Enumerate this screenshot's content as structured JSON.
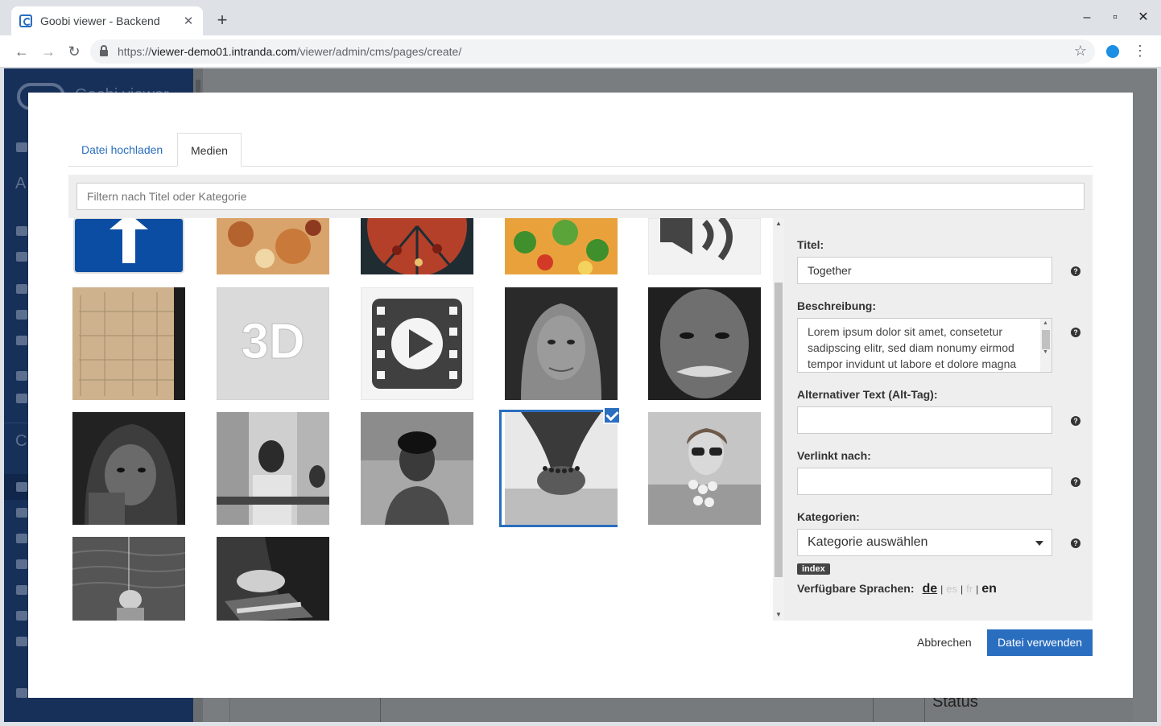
{
  "browser": {
    "tab_title": "Goobi viewer - Backend",
    "url_prefix": "https://",
    "url_host": "viewer-demo01.intranda.com",
    "url_path": "/viewer/admin/cms/pages/create/"
  },
  "background": {
    "logo_text": "Goobi viewer",
    "status_label": "Status"
  },
  "modal": {
    "tabs": [
      {
        "label": "Datei hochladen",
        "active": false
      },
      {
        "label": "Medien",
        "active": true
      }
    ],
    "filter_placeholder": "Filtern nach Titel oder Kategorie",
    "media": [
      {
        "name": "traffic-sign",
        "selected": false
      },
      {
        "name": "pizza",
        "selected": false
      },
      {
        "name": "pizza-slices",
        "selected": false
      },
      {
        "name": "pizza-vegetables",
        "selected": false
      },
      {
        "name": "audio-icon",
        "selected": false
      },
      {
        "name": "old-document",
        "selected": false
      },
      {
        "name": "3d-icon",
        "selected": false
      },
      {
        "name": "video-icon",
        "selected": false
      },
      {
        "name": "man-hood-portrait",
        "selected": false
      },
      {
        "name": "old-man-portrait",
        "selected": false
      },
      {
        "name": "man-hoodie-portrait",
        "selected": false
      },
      {
        "name": "children-bench",
        "selected": false
      },
      {
        "name": "boy-portrait",
        "selected": false
      },
      {
        "name": "holding-hands",
        "selected": true
      },
      {
        "name": "woman-sunglasses",
        "selected": false
      },
      {
        "name": "child-sea",
        "selected": false
      },
      {
        "name": "hands-book",
        "selected": false
      }
    ],
    "form": {
      "title_label": "Titel:",
      "title_value": "Together",
      "description_label": "Beschreibung:",
      "description_value": "Lorem ipsum dolor sit amet, consetetur sadipscing elitr, sed diam nonumy eirmod tempor invidunt ut labore et dolore magna",
      "alt_label": "Alternativer Text (Alt-Tag):",
      "alt_value": "",
      "link_label": "Verlinkt nach:",
      "link_value": "",
      "categories_label": "Kategorien:",
      "categories_select": "Kategorie auswählen",
      "category_badge": "index",
      "languages_label": "Verfügbare Sprachen:",
      "languages": [
        {
          "code": "de",
          "state": "active"
        },
        {
          "code": "es",
          "state": "disabled"
        },
        {
          "code": "fr",
          "state": "disabled"
        },
        {
          "code": "en",
          "state": "available"
        }
      ]
    },
    "buttons": {
      "cancel": "Abbrechen",
      "use_file": "Datei verwenden"
    }
  },
  "colors": {
    "accent": "#2a6ebf",
    "sidebar": "#17305a",
    "overlay": "#7a7d80"
  }
}
